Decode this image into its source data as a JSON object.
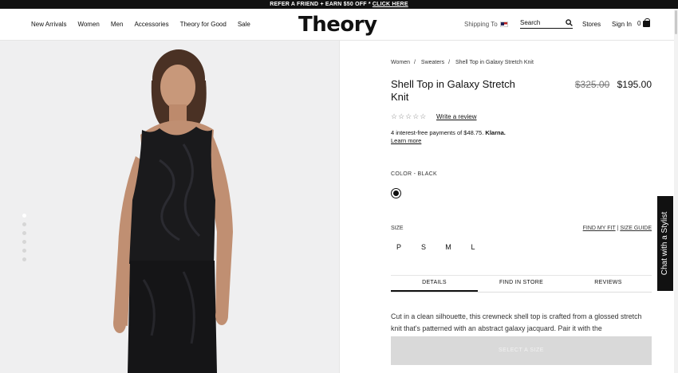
{
  "promo": {
    "text": "REFER A FRIEND + EARN $50 OFF *",
    "link": "CLICK HERE"
  },
  "nav": [
    "New Arrivals",
    "Women",
    "Men",
    "Accessories",
    "Theory for Good",
    "Sale"
  ],
  "logo": "Theory",
  "header": {
    "shipping": "Shipping To",
    "search_placeholder": "Search",
    "stores": "Stores",
    "signin": "Sign In",
    "bag_count": "0"
  },
  "breadcrumb": [
    "Women",
    "Sweaters",
    "Shell Top in Galaxy Stretch Knit"
  ],
  "product": {
    "title": "Shell Top in Galaxy Stretch Knit",
    "old_price": "$325.00",
    "price": "$195.00",
    "stars": "☆☆☆☆☆",
    "review_link": "Write a review",
    "klarna_text": "4 interest-free payments of $48.75.",
    "klarna_brand": "Klarna.",
    "learn_more": "Learn more",
    "color_label": "COLOR -",
    "color_value": "BLACK",
    "size_label": "SIZE",
    "find_fit": "FIND MY FIT",
    "size_guide": "SIZE GUIDE",
    "sizes": [
      "P",
      "S",
      "M",
      "L"
    ],
    "tabs": [
      "DETAILS",
      "FIND IN STORE",
      "REVIEWS"
    ],
    "description": "Cut in a clean silhouette, this crewneck shell top is crafted from a glossed stretch knit that's patterned with an abstract galaxy jacquard. Pair it with the",
    "add_button": "SELECT A SIZE"
  },
  "chat": "Chat with a Stylist",
  "colors": {
    "accent": "#111111",
    "button_disabled": "#d9d9d9",
    "hero_bg": "#efeff0"
  }
}
